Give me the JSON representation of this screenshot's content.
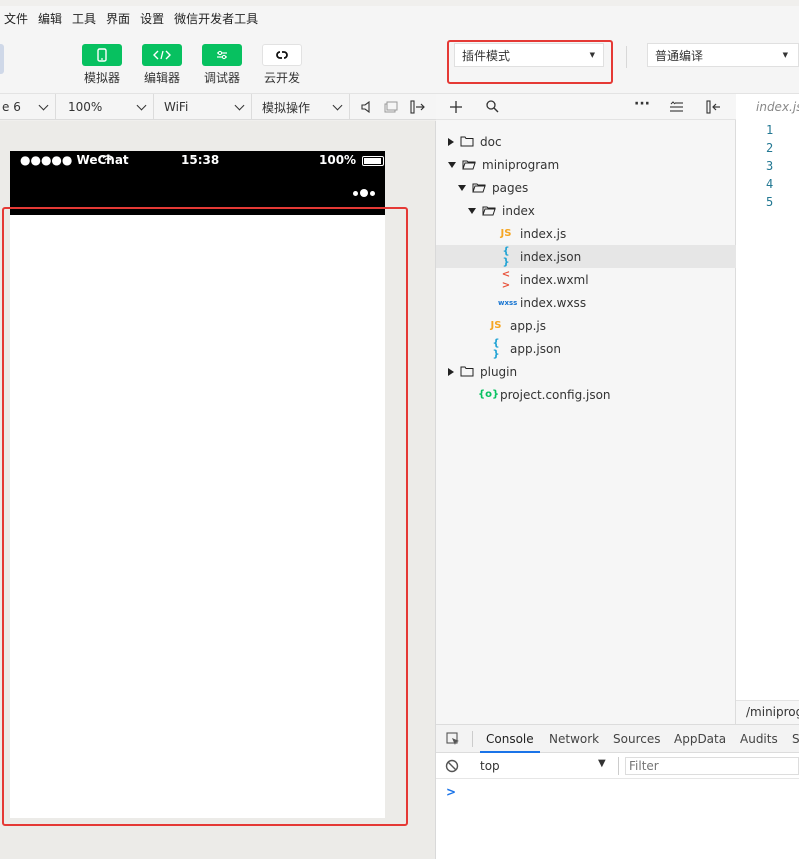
{
  "menubar": {
    "items": [
      "文件",
      "编辑",
      "工具",
      "界面",
      "设置",
      "微信开发者工具"
    ]
  },
  "toolbar": {
    "simulator_label": "模拟器",
    "editor_label": "编辑器",
    "debugger_label": "调试器",
    "cloud_label": "云开发",
    "mode_select_value": "插件模式",
    "compile_select_value": "普通编译"
  },
  "sim_toolbar": {
    "device": "e 6",
    "zoom": "100%",
    "network": "WiFi",
    "operation": "模拟操作"
  },
  "statusbar": {
    "signal": "●●●●● WeChat",
    "time": "15:38",
    "battery": "100%"
  },
  "tree": {
    "items": [
      {
        "label": "doc",
        "type": "folder",
        "expanded": false,
        "depth": 0
      },
      {
        "label": "miniprogram",
        "type": "folder",
        "expanded": true,
        "depth": 0
      },
      {
        "label": "pages",
        "type": "folder",
        "expanded": true,
        "depth": 1
      },
      {
        "label": "index",
        "type": "folder",
        "expanded": true,
        "depth": 2
      },
      {
        "label": "index.js",
        "type": "js",
        "depth": 3
      },
      {
        "label": "index.json",
        "type": "json",
        "depth": 3,
        "selected": true
      },
      {
        "label": "index.wxml",
        "type": "wxml",
        "depth": 3
      },
      {
        "label": "index.wxss",
        "type": "wxss",
        "depth": 3
      },
      {
        "label": "app.js",
        "type": "js",
        "depth": 2
      },
      {
        "label": "app.json",
        "type": "json",
        "depth": 2
      },
      {
        "label": "plugin",
        "type": "folder",
        "expanded": false,
        "depth": 0
      },
      {
        "label": "project.config.json",
        "type": "config",
        "depth": 1
      }
    ],
    "icon_text": {
      "js": "JS",
      "json": "{ }",
      "wxml": "< >",
      "wxss": "wxss",
      "config": "{o}"
    }
  },
  "editor": {
    "tab_label": "index.js",
    "line_numbers": [
      "1",
      "2",
      "3",
      "4",
      "5"
    ],
    "path": "/miniprogr"
  },
  "devtools": {
    "tabs": [
      "Console",
      "Network",
      "Sources",
      "AppData",
      "Audits",
      "S"
    ],
    "active_tab": "Console",
    "context": "top",
    "filter_placeholder": "Filter",
    "prompt": ">"
  },
  "colors": {
    "accent_green": "#07c160",
    "highlight_red": "#e53935",
    "focus_blue": "#1a73e8"
  }
}
